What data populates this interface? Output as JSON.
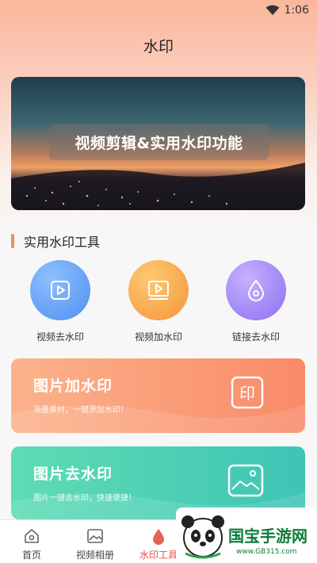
{
  "status_bar": {
    "time": "1:06"
  },
  "header": {
    "title": "水印"
  },
  "banner": {
    "caption": "视频剪辑&实用水印功能"
  },
  "section": {
    "title": "实用水印工具"
  },
  "tools": [
    {
      "label": "视频去水印",
      "icon": "play-icon",
      "color": "#4f8ff0"
    },
    {
      "label": "视频加水印",
      "icon": "video-frame-icon",
      "color": "#f4a038"
    },
    {
      "label": "链接去水印",
      "icon": "drop-icon",
      "color": "#9b7ff0"
    }
  ],
  "cards": [
    {
      "title": "图片加水印",
      "subtitle": "海量素材，一键添加水印！",
      "icon": "印",
      "color": "#fa9774"
    },
    {
      "title": "图片去水印",
      "subtitle": "图片一键去水印，快速便捷！",
      "icon": "image-icon",
      "color": "#3fcca7"
    }
  ],
  "tabs": [
    {
      "label": "首页",
      "icon": "home-icon"
    },
    {
      "label": "视频相册",
      "icon": "image-icon"
    },
    {
      "label": "水印工具",
      "icon": "watermark-icon",
      "active": true
    }
  ],
  "logo": {
    "main": "国宝手游网",
    "sub": "www.GB315.com"
  }
}
